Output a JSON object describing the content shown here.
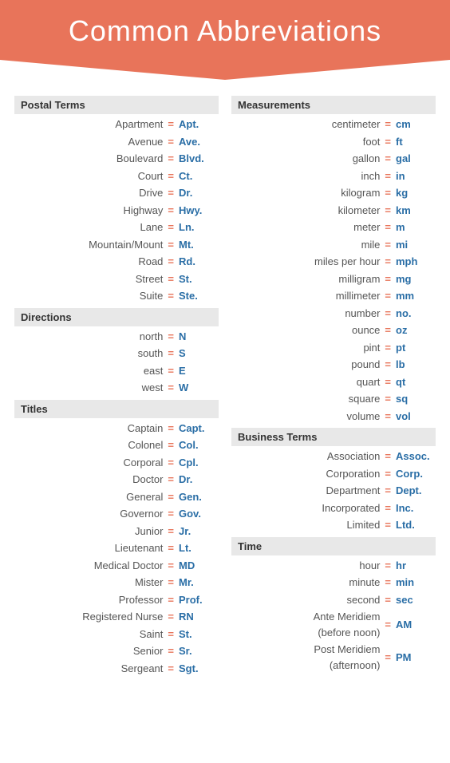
{
  "header": {
    "title": "Common Abbreviations"
  },
  "left_column": {
    "sections": [
      {
        "id": "postal",
        "label": "Postal Terms",
        "items": [
          {
            "term": "Apartment",
            "abbr": "Apt."
          },
          {
            "term": "Avenue",
            "abbr": "Ave."
          },
          {
            "term": "Boulevard",
            "abbr": "Blvd."
          },
          {
            "term": "Court",
            "abbr": "Ct."
          },
          {
            "term": "Drive",
            "abbr": "Dr."
          },
          {
            "term": "Highway",
            "abbr": "Hwy."
          },
          {
            "term": "Lane",
            "abbr": "Ln."
          },
          {
            "term": "Mountain/Mount",
            "abbr": "Mt."
          },
          {
            "term": "Road",
            "abbr": "Rd."
          },
          {
            "term": "Street",
            "abbr": "St."
          },
          {
            "term": "Suite",
            "abbr": "Ste."
          }
        ]
      },
      {
        "id": "directions",
        "label": "Directions",
        "items": [
          {
            "term": "north",
            "abbr": "N"
          },
          {
            "term": "south",
            "abbr": "S"
          },
          {
            "term": "east",
            "abbr": "E"
          },
          {
            "term": "west",
            "abbr": "W"
          }
        ]
      },
      {
        "id": "titles",
        "label": "Titles",
        "items": [
          {
            "term": "Captain",
            "abbr": "Capt."
          },
          {
            "term": "Colonel",
            "abbr": "Col."
          },
          {
            "term": "Corporal",
            "abbr": "Cpl."
          },
          {
            "term": "Doctor",
            "abbr": "Dr."
          },
          {
            "term": "General",
            "abbr": "Gen."
          },
          {
            "term": "Governor",
            "abbr": "Gov."
          },
          {
            "term": "Junior",
            "abbr": "Jr."
          },
          {
            "term": "Lieutenant",
            "abbr": "Lt."
          },
          {
            "term": "Medical Doctor",
            "abbr": "MD"
          },
          {
            "term": "Mister",
            "abbr": "Mr."
          },
          {
            "term": "Professor",
            "abbr": "Prof."
          },
          {
            "term": "Registered Nurse",
            "abbr": "RN"
          },
          {
            "term": "Saint",
            "abbr": "St."
          },
          {
            "term": "Senior",
            "abbr": "Sr."
          },
          {
            "term": "Sergeant",
            "abbr": "Sgt."
          }
        ]
      }
    ]
  },
  "right_column": {
    "sections": [
      {
        "id": "measurements",
        "label": "Measurements",
        "items": [
          {
            "term": "centimeter",
            "abbr": "cm"
          },
          {
            "term": "foot",
            "abbr": "ft"
          },
          {
            "term": "gallon",
            "abbr": "gal"
          },
          {
            "term": "inch",
            "abbr": "in"
          },
          {
            "term": "kilogram",
            "abbr": "kg"
          },
          {
            "term": "kilometer",
            "abbr": "km"
          },
          {
            "term": "meter",
            "abbr": "m"
          },
          {
            "term": "mile",
            "abbr": "mi"
          },
          {
            "term": "miles per hour",
            "abbr": "mph"
          },
          {
            "term": "milligram",
            "abbr": "mg"
          },
          {
            "term": "millimeter",
            "abbr": "mm"
          },
          {
            "term": "number",
            "abbr": "no."
          },
          {
            "term": "ounce",
            "abbr": "oz"
          },
          {
            "term": "pint",
            "abbr": "pt"
          },
          {
            "term": "pound",
            "abbr": "lb"
          },
          {
            "term": "quart",
            "abbr": "qt"
          },
          {
            "term": "square",
            "abbr": "sq"
          },
          {
            "term": "volume",
            "abbr": "vol"
          }
        ]
      },
      {
        "id": "business",
        "label": "Business Terms",
        "items": [
          {
            "term": "Association",
            "abbr": "Assoc."
          },
          {
            "term": "Corporation",
            "abbr": "Corp."
          },
          {
            "term": "Department",
            "abbr": "Dept."
          },
          {
            "term": "Incorporated",
            "abbr": "Inc."
          },
          {
            "term": "Limited",
            "abbr": "Ltd."
          }
        ]
      },
      {
        "id": "time",
        "label": "Time",
        "items": [
          {
            "term": "hour",
            "abbr": "hr"
          },
          {
            "term": "minute",
            "abbr": "min"
          },
          {
            "term": "second",
            "abbr": "sec"
          },
          {
            "term": "Ante Meridiem\n(before noon)",
            "abbr": "AM"
          },
          {
            "term": "Post Meridiem\n(afternoon)",
            "abbr": "PM"
          }
        ]
      }
    ]
  },
  "equals_sign": "=",
  "accent_color": "#e8745a",
  "abbr_color": "#2a6ea6",
  "text_color": "#555"
}
